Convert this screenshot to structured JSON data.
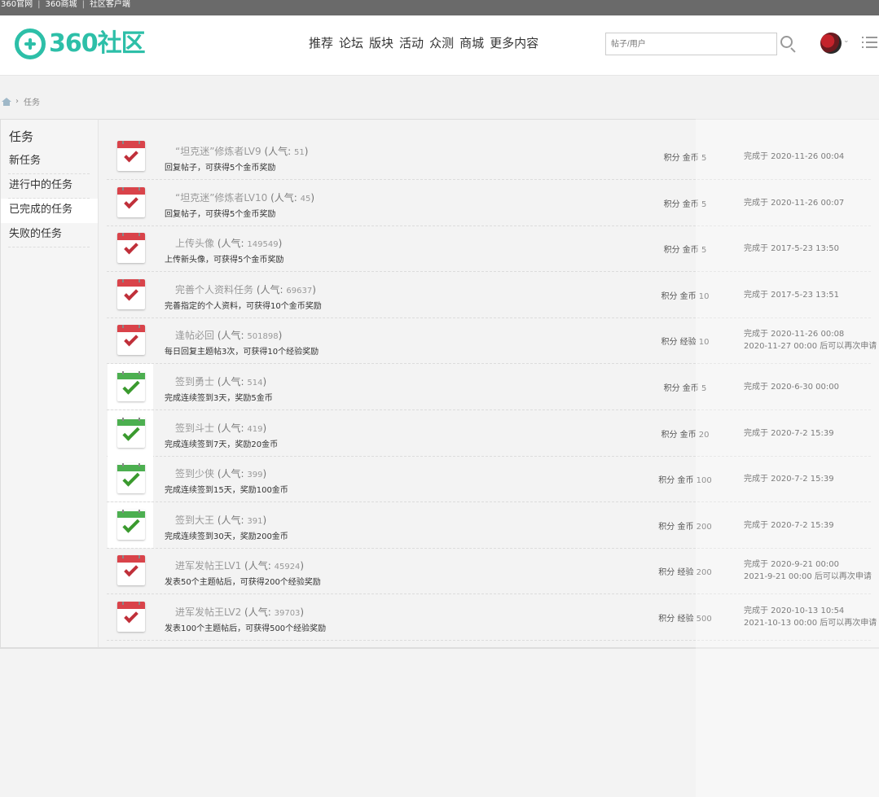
{
  "topbar": {
    "links": [
      "360官网",
      "360商城",
      "社区客户端"
    ],
    "separator": "|"
  },
  "header": {
    "logo_text": "360社区",
    "nav": [
      "推荐",
      "论坛",
      "版块",
      "活动",
      "众测",
      "商城",
      "更多内容"
    ],
    "search_placeholder": "帖子/用户",
    "avatar_caret": "⌄"
  },
  "breadcrumb": {
    "current": "任务",
    "separator": "›"
  },
  "sidebar": {
    "title": "任务",
    "items": [
      "新任务",
      "进行中的任务",
      "已完成的任务",
      "失败的任务"
    ],
    "active_index": 2
  },
  "colors": {
    "brand": "#2dbfa8",
    "calendar_red": "#d9434a",
    "calendar_green": "#4caf50"
  },
  "tasks": [
    {
      "icon": "red-calendar-check-icon",
      "name": "“坦克迷”修炼者LV9",
      "pop_label": "(人气:",
      "pop": "51",
      "pop_close": ")",
      "desc": "回复帖子，可获得5个金币奖励",
      "reward": "积分 金币 5",
      "status1": "完成于 2020-11-26 00:04",
      "status2": ""
    },
    {
      "icon": "red-calendar-check-icon",
      "name": "“坦克迷”修炼者LV10",
      "pop_label": "(人气:",
      "pop": "45",
      "pop_close": ")",
      "desc": "回复帖子，可获得5个金币奖励",
      "reward": "积分 金币 5",
      "status1": "完成于 2020-11-26 00:07",
      "status2": ""
    },
    {
      "icon": "red-calendar-check-icon",
      "name": "上传头像",
      "pop_label": "(人气:",
      "pop": "149549",
      "pop_close": ")",
      "desc": "上传新头像，可获得5个金币奖励",
      "reward": "积分 金币 5",
      "status1": "完成于 2017-5-23 13:50",
      "status2": ""
    },
    {
      "icon": "red-calendar-check-icon",
      "name": "完善个人资料任务",
      "pop_label": "(人气:",
      "pop": "69637",
      "pop_close": ")",
      "desc": "完善指定的个人资料，可获得10个金币奖励",
      "reward": "积分 金币 10",
      "status1": "完成于 2017-5-23 13:51",
      "status2": ""
    },
    {
      "icon": "red-calendar-check-icon",
      "name": "逢帖必回",
      "pop_label": "(人气:",
      "pop": "501898",
      "pop_close": ")",
      "desc": "每日回复主题帖3次，可获得10个经验奖励",
      "reward": "积分 经验 10",
      "status1": "完成于 2020-11-26 00:08",
      "status2": "2020-11-27 00:00 后可以再次申请"
    },
    {
      "icon": "green-calendar-check-icon",
      "name": "签到勇士",
      "pop_label": "(人气:",
      "pop": "514",
      "pop_close": ")",
      "desc": "完成连续签到3天，奖励5金币",
      "reward": "积分 金币 5",
      "status1": "完成于 2020-6-30 00:00",
      "status2": ""
    },
    {
      "icon": "green-calendar-check-icon",
      "name": "签到斗士",
      "pop_label": "(人气:",
      "pop": "419",
      "pop_close": ")",
      "desc": "完成连续签到7天，奖励20金币",
      "reward": "积分 金币 20",
      "status1": "完成于 2020-7-2 15:39",
      "status2": ""
    },
    {
      "icon": "green-calendar-check-icon",
      "name": "签到少侠",
      "pop_label": "(人气:",
      "pop": "399",
      "pop_close": ")",
      "desc": "完成连续签到15天，奖励100金币",
      "reward": "积分 金币 100",
      "status1": "完成于 2020-7-2 15:39",
      "status2": ""
    },
    {
      "icon": "green-calendar-check-icon",
      "name": "签到大王",
      "pop_label": "(人气:",
      "pop": "391",
      "pop_close": ")",
      "desc": "完成连续签到30天，奖励200金币",
      "reward": "积分 金币 200",
      "status1": "完成于 2020-7-2 15:39",
      "status2": ""
    },
    {
      "icon": "red-calendar-check-icon",
      "name": "进军发帖王LV1",
      "pop_label": "(人气:",
      "pop": "45924",
      "pop_close": ")",
      "desc": "发表50个主题帖后，可获得200个经验奖励",
      "reward": "积分 经验 200",
      "status1": "完成于 2020-9-21 00:00",
      "status2": "2021-9-21 00:00 后可以再次申请"
    },
    {
      "icon": "red-calendar-check-icon",
      "name": "进军发帖王LV2",
      "pop_label": "(人气:",
      "pop": "39703",
      "pop_close": ")",
      "desc": "发表100个主题帖后，可获得500个经验奖励",
      "reward": "积分 经验 500",
      "status1": "完成于 2020-10-13 10:54",
      "status2": "2021-10-13 00:00 后可以再次申请"
    }
  ]
}
